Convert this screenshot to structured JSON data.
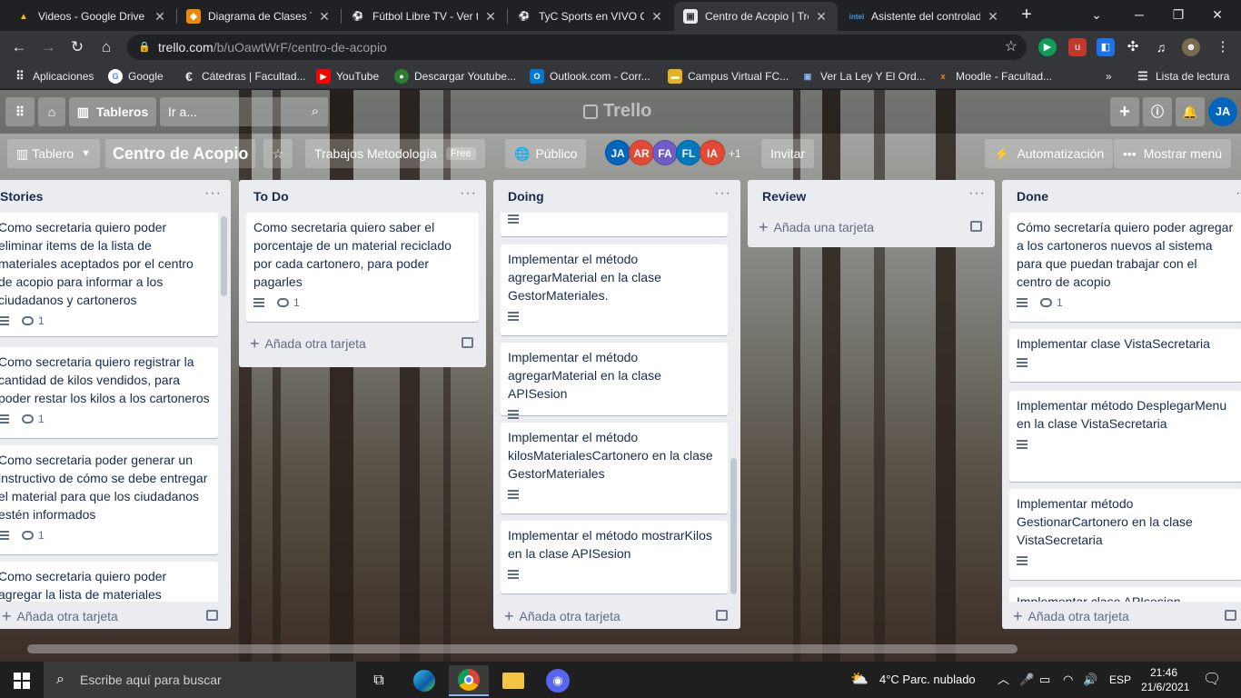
{
  "browser": {
    "tabs": [
      {
        "title": "Videos - Google Drive",
        "favicon": "google-drive-icon",
        "color": "#34a853",
        "glyph": "▲",
        "active": false
      },
      {
        "title": "Diagrama de Clases TF",
        "favicon": "drawio-icon",
        "color": "#f08705",
        "glyph": "◆",
        "active": false
      },
      {
        "title": "Fútbol Libre TV - Ver tu",
        "favicon": "soccer-ball-icon",
        "color": "#ffffff",
        "glyph": "⚽",
        "active": false
      },
      {
        "title": "TyC Sports en VIVO ON",
        "favicon": "soccer-ball-icon",
        "color": "#ffffff",
        "glyph": "⚽",
        "active": false
      },
      {
        "title": "Centro de Acopio | Trello",
        "favicon": "trello-icon",
        "color": "#ffffff",
        "glyph": "▣",
        "active": true
      },
      {
        "title": "Asistente del controlador",
        "favicon": "intel-icon",
        "color": "#0071c5",
        "glyph": "intel",
        "active": false
      }
    ],
    "new_tab": "+",
    "address": {
      "host": "trello.com",
      "path": "/b/uOawtWrF/centro-de-acopio"
    },
    "bookmarks": [
      {
        "label": "Aplicaciones",
        "icon": "apps-grid-icon",
        "color": "#4285f4"
      },
      {
        "label": "Google",
        "icon": "google-icon",
        "color": "#ea4335"
      },
      {
        "label": "Cátedras | Facultad...",
        "icon": "edge-e-icon",
        "color": "#3c3c3c"
      },
      {
        "label": "YouTube",
        "icon": "youtube-icon",
        "color": "#ff0000"
      },
      {
        "label": "Descargar Youtube...",
        "icon": "download-icon",
        "color": "#c0392b"
      },
      {
        "label": "Outlook.com - Corr...",
        "icon": "outlook-icon",
        "color": "#0078d4"
      },
      {
        "label": "Campus Virtual FC...",
        "icon": "campus-icon",
        "color": "#e6b422"
      },
      {
        "label": "Ver La Ley Y El Ord...",
        "icon": "tv-icon",
        "color": "#5b6b7b"
      },
      {
        "label": "Moodle - Facultad...",
        "icon": "moodle-icon",
        "color": "#f98012"
      }
    ],
    "reading_list": "Lista de lectura",
    "overflow": "»"
  },
  "trello": {
    "header": {
      "boards_button": "Tableros",
      "search_placeholder": "Ir a...",
      "logo_text": "Trello",
      "user_initials": "JA"
    },
    "board": {
      "view_label": "Tablero",
      "title": "Centro de Acopio",
      "workspace": "Trabajos Metodología",
      "workspace_badge": "Free",
      "visibility": "Público",
      "members": [
        {
          "initials": "JA",
          "color": "#0065bd"
        },
        {
          "initials": "AR",
          "color": "#e34935"
        },
        {
          "initials": "FA",
          "color": "#6e5dc6"
        },
        {
          "initials": "FL",
          "color": "#0079bf"
        },
        {
          "initials": "IA",
          "color": "#e34935"
        }
      ],
      "more_members": "+1",
      "invite": "Invitar",
      "automation": "Automatización",
      "menu": "Mostrar menú"
    },
    "lists": [
      {
        "title": "Stories",
        "add_label": "Añada otra tarjeta",
        "cards": [
          {
            "text": "Como secretaria quiero poder eliminar items de la lista de materiales aceptados por el centro de acopio para informar a los ciudadanos y cartoneros",
            "comments": "1"
          },
          {
            "text": "Como secretaria quiero registrar la cantidad de kilos vendidos, para poder restar los kilos a los cartoneros",
            "comments": "1"
          },
          {
            "text": "Como secretaria poder generar un instructivo de cómo se debe entregar el material para que los ciudadanos estén informados",
            "comments": "1"
          },
          {
            "text": "Como secretaria quiero poder agregar la lista de materiales",
            "comments": ""
          }
        ]
      },
      {
        "title": "To Do",
        "add_label": "Añada otra tarjeta",
        "cards": [
          {
            "text": "Como secretaria quiero saber el porcentaje de un material reciclado por cada cartonero, para poder pagarles",
            "comments": "1"
          }
        ]
      },
      {
        "title": "Doing",
        "add_label": "Añada otra tarjeta",
        "cards": [
          {
            "text": "",
            "comments": ""
          },
          {
            "text": "Implementar el método agregarMaterial en la clase GestorMateriales.",
            "comments": ""
          },
          {
            "text": "Implementar el método agregarMaterial en la clase APISesion",
            "comments": ""
          },
          {
            "text": "Implementar el método kilosMaterialesCartonero en la clase GestorMateriales",
            "comments": ""
          },
          {
            "text": "Implementar el método mostrarKilos en la clase APISesion",
            "comments": ""
          }
        ]
      },
      {
        "title": "Review",
        "add_label": "Añada una tarjeta",
        "cards": []
      },
      {
        "title": "Done",
        "add_label": "Añada otra tarjeta",
        "cards": [
          {
            "text": "Cómo secretaría quiero poder agregar a los cartoneros nuevos al sistema para que puedan trabajar con el centro de acopio",
            "comments": "1"
          },
          {
            "text": "Implementar clase VistaSecretaria",
            "comments": ""
          },
          {
            "text": "Implementar método DesplegarMenu en la clase VistaSecretaria",
            "comments": ""
          },
          {
            "text": "Implementar método GestionarCartonero en la clase VistaSecretaria",
            "comments": ""
          },
          {
            "text": "Implementar clase APIsesion",
            "comments": ""
          }
        ]
      }
    ]
  },
  "taskbar": {
    "search_placeholder": "Escribe aquí para buscar",
    "weather": "4°C  Parc. nublado",
    "language": "ESP",
    "time": "21:46",
    "date": "21/6/2021"
  }
}
